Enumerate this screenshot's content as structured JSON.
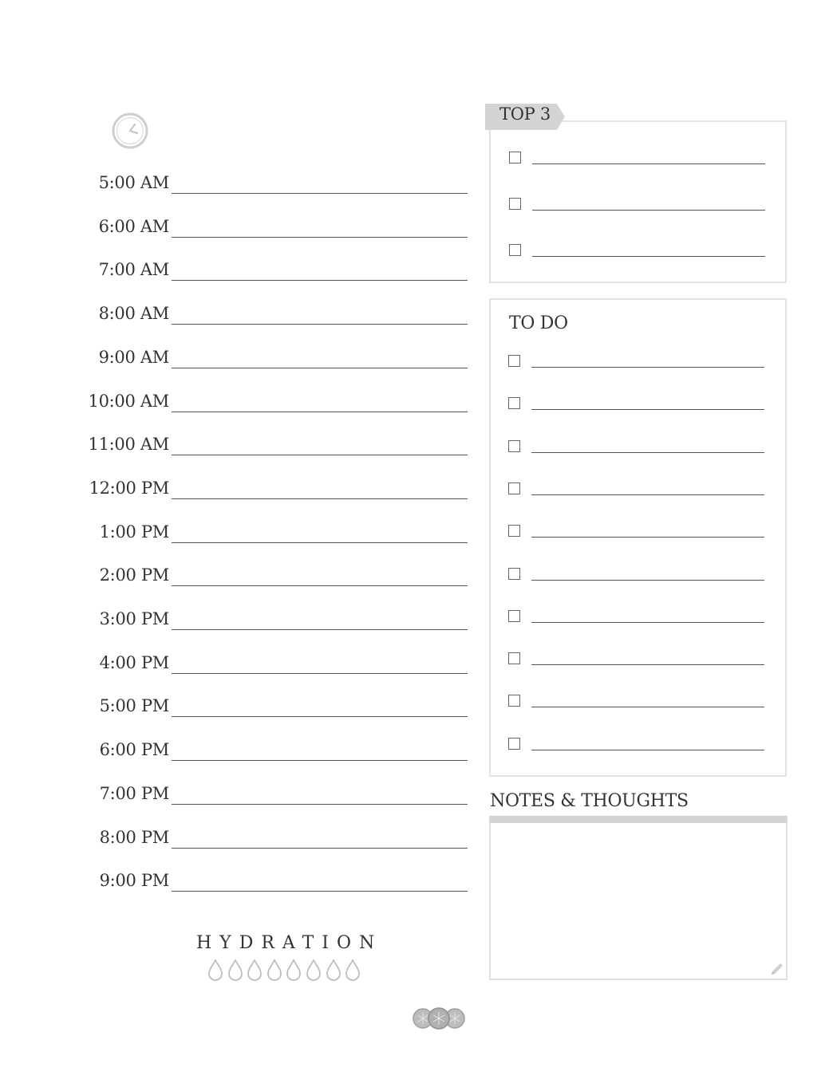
{
  "schedule": {
    "times": [
      "5:00 AM",
      "6:00 AM",
      "7:00 AM",
      "8:00 AM",
      "9:00 AM",
      "10:00 AM",
      "11:00 AM",
      "12:00 PM",
      "1:00 PM",
      "2:00 PM",
      "3:00 PM",
      "4:00 PM",
      "5:00 PM",
      "6:00 PM",
      "7:00 PM",
      "8:00 PM",
      "9:00 PM"
    ]
  },
  "top3": {
    "title": "TOP 3",
    "item_count": 3
  },
  "todo": {
    "title": "TO DO",
    "item_count": 10
  },
  "notes": {
    "title": "NOTES & THOUGHTS"
  },
  "hydration": {
    "title": "HYDRATION",
    "drop_count": 8
  },
  "icons": {
    "schedule": "clock-icon",
    "notes": "pencil-icon",
    "hydration": "water-drop-icon",
    "footer": "logo-circles-icon"
  },
  "colors": {
    "text": "#333333",
    "line": "#555555",
    "box_border": "#e3e3e3",
    "tab_fill": "#d4d4d4",
    "icon_gray": "#bdbdbd"
  }
}
